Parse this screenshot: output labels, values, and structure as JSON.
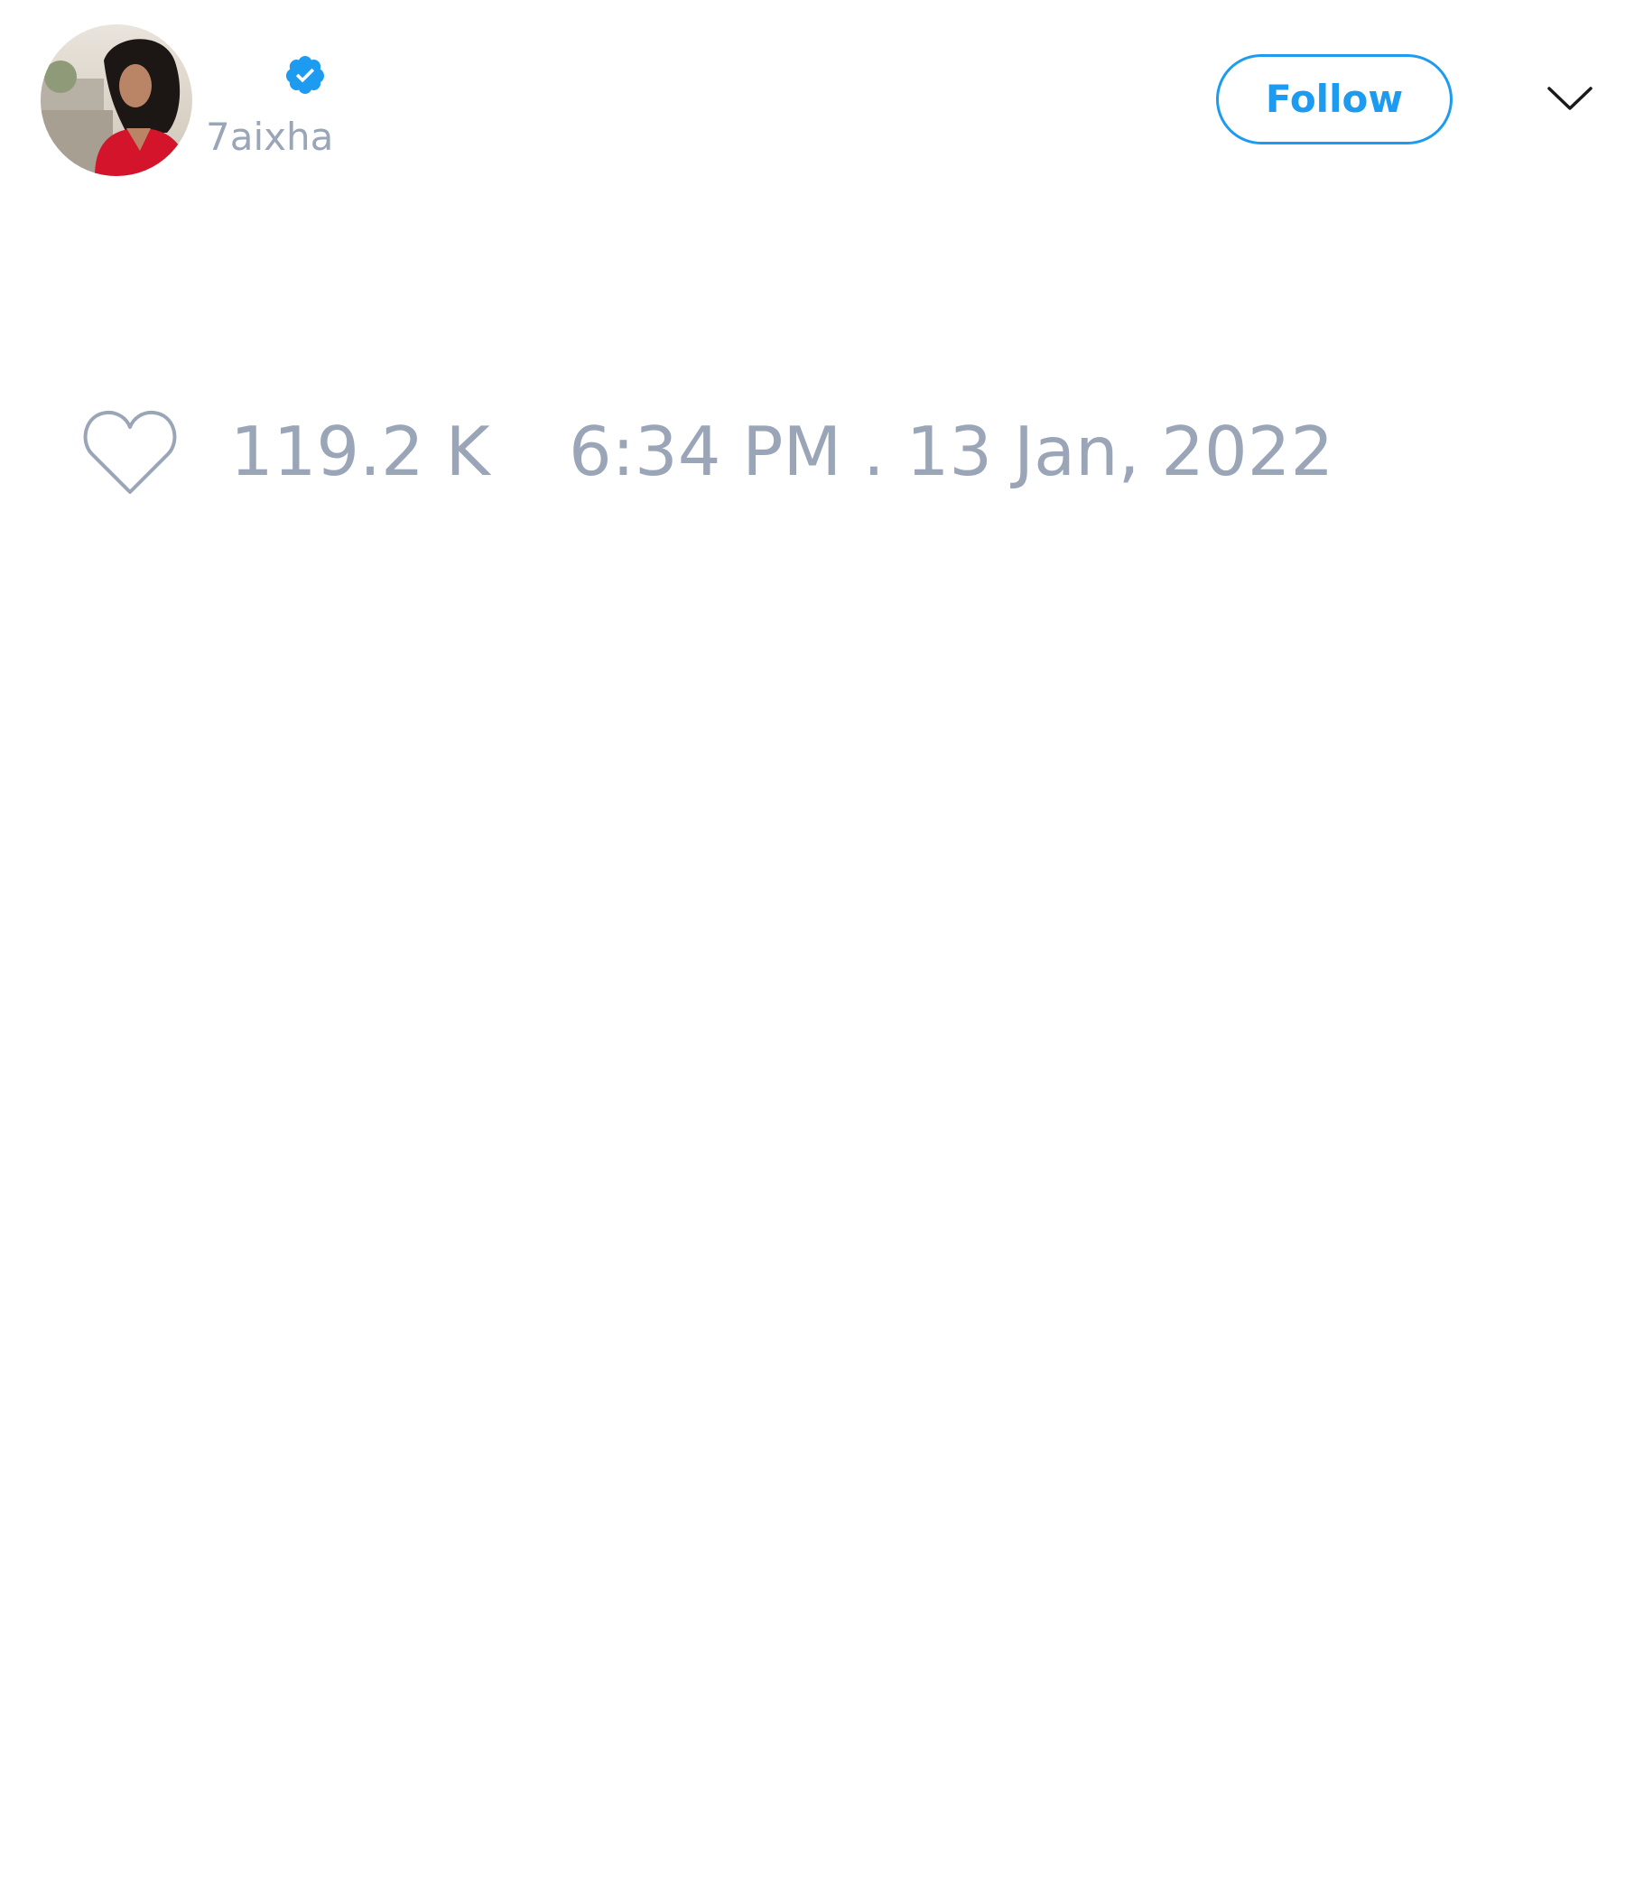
{
  "tweet": {
    "author": {
      "display_name": "",
      "handle": "7aixha",
      "verified": true,
      "avatar": "profile-photo-woman-red-top"
    },
    "follow_label": "Follow",
    "menu_icon": "chevron-down-icon",
    "likes": {
      "icon": "heart-icon",
      "count": "119.2 K"
    },
    "timestamp": "6:34 PM . 13 Jan, 2022"
  },
  "colors": {
    "accent": "#1d9bf0",
    "muted_text": "#9aa6b8",
    "background": "#ffffff"
  }
}
